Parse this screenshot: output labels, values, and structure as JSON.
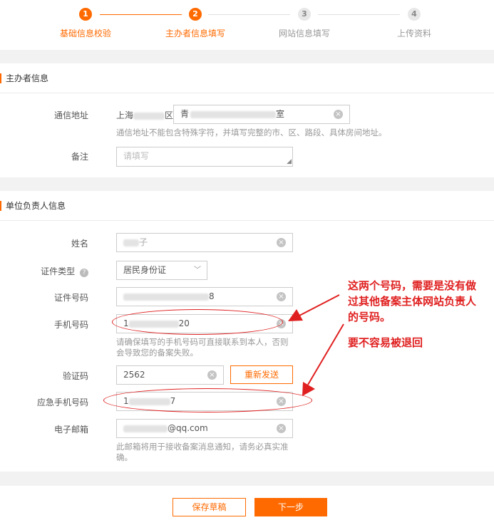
{
  "steps": [
    {
      "num": "1",
      "label": "基础信息校验"
    },
    {
      "num": "2",
      "label": "主办者信息填写"
    },
    {
      "num": "3",
      "label": "网站信息填写"
    },
    {
      "num": "4",
      "label": "上传资料"
    }
  ],
  "sponsor": {
    "title": "主办者信息",
    "address_label": "通信地址",
    "address_prefix_a": "上海",
    "address_prefix_b": "区",
    "address_value_a": "青",
    "address_value_b": "室",
    "address_help": "通信地址不能包含特殊字符，并填写完整的市、区、路段、具体房间地址。",
    "note_label": "备注",
    "note_placeholder": "请填写"
  },
  "responsible": {
    "title": "单位负责人信息",
    "name_label": "姓名",
    "name_value_tail": "子",
    "id_type_label": "证件类型",
    "id_type_value": "居民身份证",
    "id_number_label": "证件号码",
    "id_number_tail": "8",
    "phone_label": "手机号码",
    "phone_head": "1",
    "phone_tail": "20",
    "phone_help": "请确保填写的手机号码可直接联系到本人，否则会导致您的备案失败。",
    "code_label": "验证码",
    "code_value": "2562",
    "resend_label": "重新发送",
    "emergency_label": "应急手机号码",
    "emergency_head": "1",
    "emergency_tail": "7",
    "email_label": "电子邮箱",
    "email_tail": "@qq.com",
    "email_help": "此邮箱将用于接收备案消息通知，请务必真实准确。"
  },
  "annotation": {
    "line1": "这两个号码，需要是没有做",
    "line2": "过其他备案主体网站负责人",
    "line3": "的号码。",
    "line4": "要不容易被退回"
  },
  "footer": {
    "save_label": "保存草稿",
    "next_label": "下一步"
  },
  "colors": {
    "accent": "#ff6a00",
    "annotation": "#e02020"
  }
}
